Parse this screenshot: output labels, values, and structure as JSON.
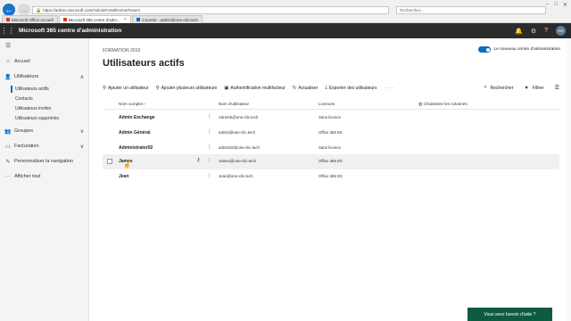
{
  "browser": {
    "address": "https://admin.microsoft.com/AdminPortal/Home#/users",
    "search_placeholder": "Rechercher...",
    "tabs": [
      {
        "label": "Microsoft Office Accueil"
      },
      {
        "label": "Microsoft 365 centre d'adm..."
      },
      {
        "label": "Courrier - admin@one-clic.tech"
      }
    ],
    "window_controls": [
      "–",
      "□",
      "✕"
    ]
  },
  "header": {
    "app_title": "Microsoft 365 centre d'administration",
    "avatar_initials": "AG",
    "icons": [
      "bell-icon",
      "gear-icon",
      "help-icon"
    ]
  },
  "sidebar": {
    "items": [
      {
        "label": "Accueil",
        "icon": "home-icon"
      },
      {
        "label": "Utilisateurs",
        "icon": "user-icon",
        "expanded": true
      },
      {
        "label": "Groupes",
        "icon": "group-icon"
      },
      {
        "label": "Facturation",
        "icon": "billing-icon"
      },
      {
        "label": "Personnaliser la navigation",
        "icon": "edit-icon"
      },
      {
        "label": "Afficher tout",
        "icon": "ellipsis-icon"
      }
    ],
    "users_sub": [
      {
        "label": "Utilisateurs actifs",
        "active": true
      },
      {
        "label": "Contacts"
      },
      {
        "label": "Utilisateurs invités"
      },
      {
        "label": "Utilisateurs supprimés"
      }
    ]
  },
  "main": {
    "subtitle": "FORMATION 2019",
    "title": "Utilisateurs actifs",
    "toggle_label": "Le nouveau centre d'administration",
    "toggle_on": true,
    "toolbar": {
      "add_user": "Ajouter un utilisateur",
      "add_multiple": "Ajouter plusieurs utilisateurs",
      "mfa": "Authentification multifacteur",
      "refresh": "Actualiser",
      "export": "Exporter des utilisateurs",
      "more": "···",
      "search": "Rechercher",
      "filter": "Filtrer"
    },
    "table": {
      "headers": {
        "name": "Nom complet ↑",
        "username": "Nom d'utilisateur",
        "licenses": "Licences",
        "columns": "Choisissez les colonnes"
      },
      "rows": [
        {
          "name": "Admin Exchange",
          "username": "AdminE@one-clic.tech",
          "licenses": "Sans licence"
        },
        {
          "name": "Admin Général",
          "username": "admin@one-clic.tech",
          "licenses": "Office 365 E5"
        },
        {
          "name": "Administrator02",
          "username": "admin02@one-clic.tech",
          "licenses": "Sans licence"
        },
        {
          "name": "James",
          "username": "James@one-clic.tech",
          "licenses": "Office 365 E5"
        },
        {
          "name": "Jean",
          "username": "Jean@one-clic.tech",
          "licenses": "Office 365 E5"
        }
      ]
    }
  },
  "help_button": "Vous avez besoin d'aide ?"
}
